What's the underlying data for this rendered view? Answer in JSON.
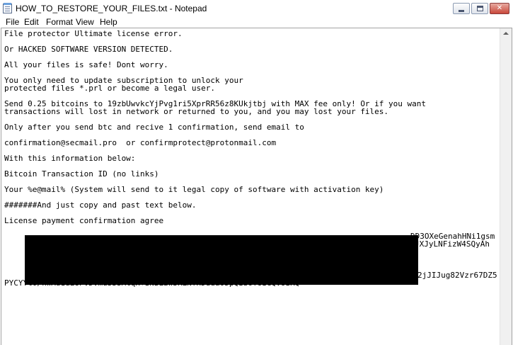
{
  "window": {
    "title": "HOW_TO_RESTORE_YOUR_FILES.txt - Notepad"
  },
  "menu": {
    "items": [
      "File",
      "Edit",
      "Format",
      "View",
      "Help"
    ]
  },
  "document": {
    "lines": [
      "File protector Ultimate license error.",
      "Or HACKED SOFTWARE VERSION DETECTED.",
      "All your files is safe! Dont worry.",
      "You only need to update subscription to unlock your",
      "protected files *.prl or become a legal user.",
      "Send 0.25 bitcoins to 19zbUwvkcYjPvg1ri5XprRR56z8KUkjtbj with MAX fee only! Or if you want",
      "transactions will lost in network or returned to you, and you may lost your files.",
      "Only after you send btc and recive 1 confirmation, send email to",
      "confirmation@secmail.pro  or confirmprotect@protonmail.com",
      "With this information below:",
      "Bitcoin Transaction ID (no links)",
      "Your %e@mail% (System will send to it legal copy of software with activation key)",
      "#######And just copy and past text below.",
      "License payment confirmation agree"
    ],
    "key_fragments": {
      "line1_right": "DD3OXeGenahHNi1gsm",
      "line2_right": "JXJyLNFizW4SQyAh",
      "line5_right": "2jJIJug82Vzr67DZ5",
      "line6": "PYCYYt0/kwAd1uE8PvDvmu33SMtqx+INBLzw3RLNTxDdda05pQIb6YoIGQvoIRQ="
    }
  }
}
